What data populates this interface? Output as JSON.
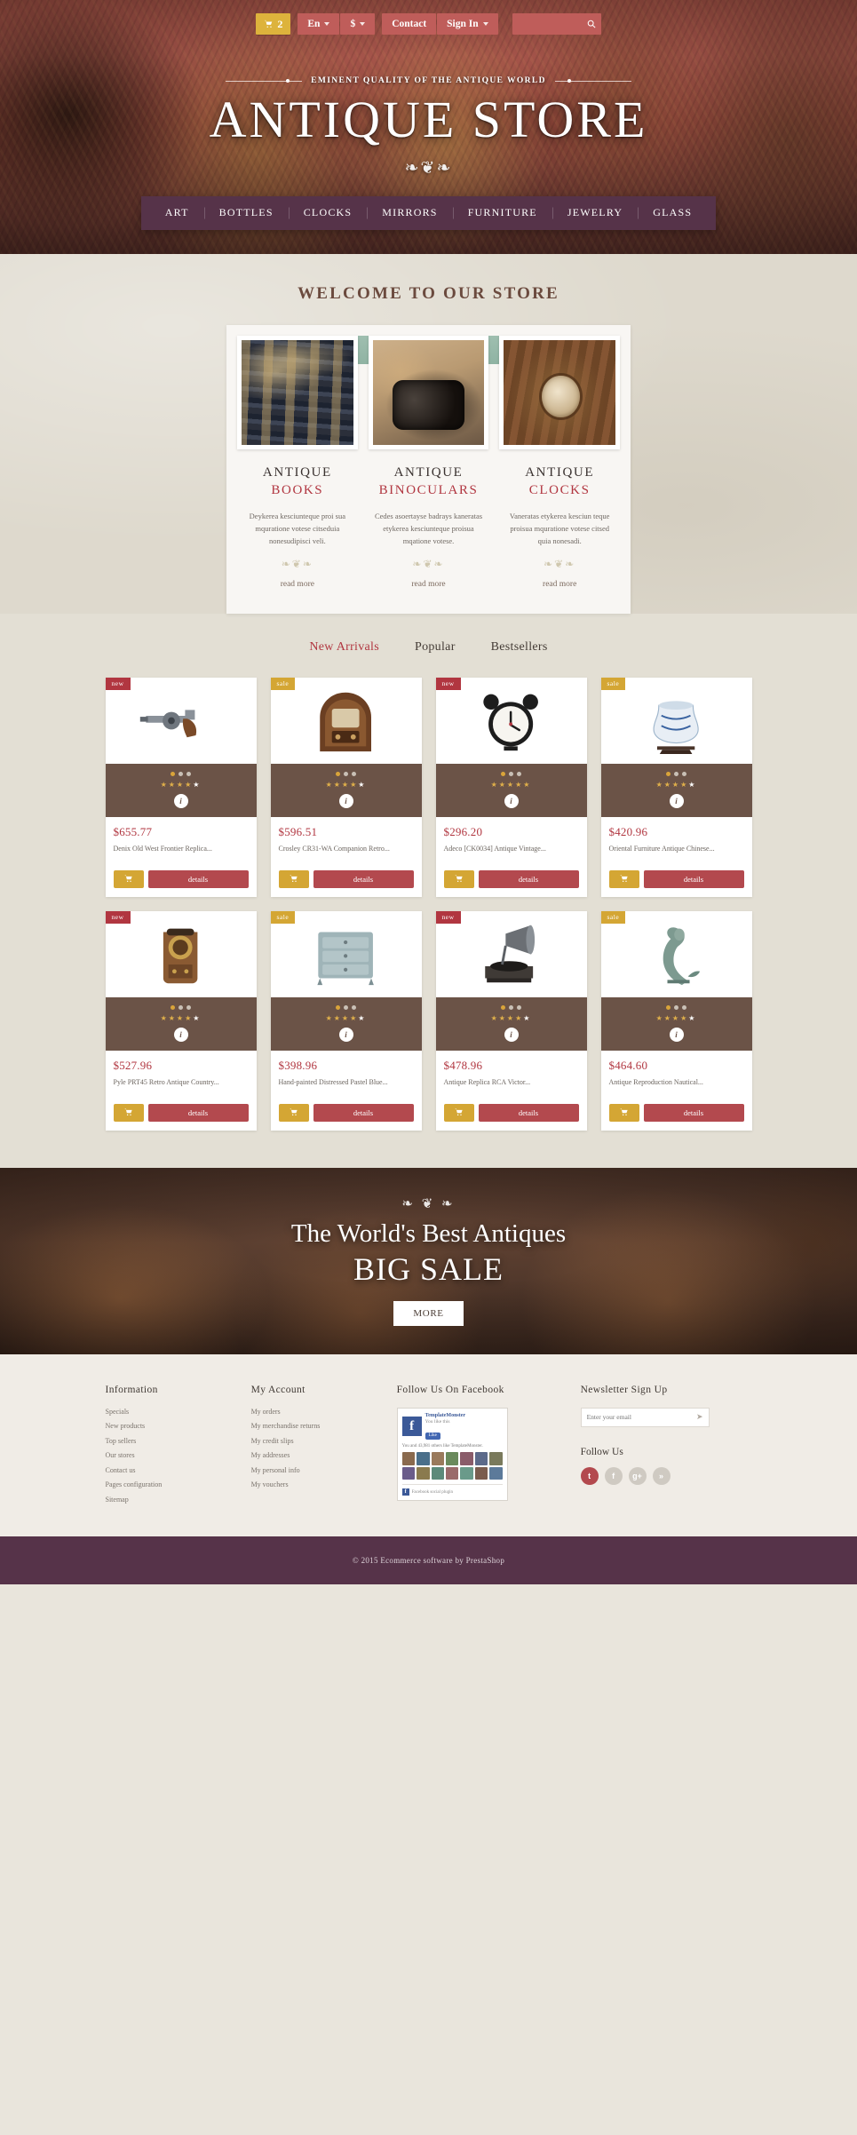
{
  "topbar": {
    "cart_count": "2",
    "cart_icon": "shopping-cart-icon",
    "language": "En",
    "currency": "$",
    "contact_label": "Contact",
    "signin_label": "Sign In",
    "search_placeholder": "",
    "search_value": "",
    "search_icon": "search-icon"
  },
  "hero": {
    "tagline": "EMINENT QUALITY OF THE ANTIQUE WORLD",
    "title": "ANTIQUE STORE",
    "flourish": "❧❦❧"
  },
  "nav": {
    "items": [
      {
        "label": "ART"
      },
      {
        "label": "BOTTLES"
      },
      {
        "label": "CLOCKS"
      },
      {
        "label": "MIRRORS"
      },
      {
        "label": "FURNITURE"
      },
      {
        "label": "JEWELRY"
      },
      {
        "label": "GLASS"
      }
    ]
  },
  "welcome": {
    "title": "WELCOME TO OUR STORE",
    "cards": [
      {
        "line1": "ANTIQUE",
        "line2": "BOOKS",
        "desc": "Deykerea kesciunteque proi sua mquratione votese citseduia nonesudipisci veli.",
        "ornament": "❧❦❧",
        "readmore": "read more",
        "image": "antique-books-image"
      },
      {
        "line1": "ANTIQUE",
        "line2": "BINOCULARS",
        "desc": "Cedes asoertayse badrays kaneratas etykerea kesciunteque proisua mqatione votese.",
        "ornament": "❧❦❧",
        "readmore": "read more",
        "image": "antique-binoculars-image"
      },
      {
        "line1": "ANTIQUE",
        "line2": "CLOCKS",
        "desc": "Vaneratas etykerea kesciun teque proisua mquratione votese citsed quia nonesadi.",
        "ornament": "❧❦❧",
        "readmore": "read more",
        "image": "antique-clocks-image"
      }
    ]
  },
  "products": {
    "tabs": [
      {
        "label": "New Arrivals",
        "active": true
      },
      {
        "label": "Popular",
        "active": false
      },
      {
        "label": "Bestsellers",
        "active": false
      }
    ],
    "items": [
      {
        "badge": "new",
        "badge_type": "new",
        "price": "$655.77",
        "name": "Denix Old West Frontier Replica...",
        "rating": 4,
        "dots": 3,
        "dots_active": 1,
        "image": "revolver-pistol-image",
        "details_label": "details",
        "cart_icon": "shopping-bag-icon",
        "info_icon": "info-icon"
      },
      {
        "badge": "sale",
        "badge_type": "sale",
        "price": "$596.51",
        "name": "Crosley CR31-WA Companion Retro...",
        "rating": 4,
        "dots": 3,
        "dots_active": 1,
        "image": "vintage-radio-image",
        "details_label": "details",
        "cart_icon": "shopping-bag-icon",
        "info_icon": "info-icon"
      },
      {
        "badge": "new",
        "badge_type": "new",
        "price": "$296.20",
        "name": "Adeco [CK0034] Antique Vintage...",
        "rating": 5,
        "dots": 3,
        "dots_active": 1,
        "image": "alarm-clock-image",
        "details_label": "details",
        "cart_icon": "shopping-bag-icon",
        "info_icon": "info-icon"
      },
      {
        "badge": "sale",
        "badge_type": "sale",
        "price": "$420.96",
        "name": "Oriental Furniture Antique Chinese...",
        "rating": 4,
        "dots": 3,
        "dots_active": 1,
        "image": "porcelain-vase-image",
        "details_label": "details",
        "cart_icon": "shopping-bag-icon",
        "info_icon": "info-icon"
      },
      {
        "badge": "new",
        "badge_type": "new",
        "price": "$527.96",
        "name": "Pyle PRT45 Retro Antique Country...",
        "rating": 4,
        "dots": 3,
        "dots_active": 1,
        "image": "antique-telephone-image",
        "details_label": "details",
        "cart_icon": "shopping-bag-icon",
        "info_icon": "info-icon"
      },
      {
        "badge": "sale",
        "badge_type": "sale",
        "price": "$398.96",
        "name": "Hand-painted Distressed Pastel Blue...",
        "rating": 4,
        "dots": 3,
        "dots_active": 1,
        "image": "dresser-cabinet-image",
        "details_label": "details",
        "cart_icon": "shopping-bag-icon",
        "info_icon": "info-icon"
      },
      {
        "badge": "new",
        "badge_type": "new",
        "price": "$478.96",
        "name": "Antique Replica RCA Victor...",
        "rating": 4,
        "dots": 3,
        "dots_active": 1,
        "image": "gramophone-image",
        "details_label": "details",
        "cart_icon": "shopping-bag-icon",
        "info_icon": "info-icon"
      },
      {
        "badge": "sale",
        "badge_type": "sale",
        "price": "$464.60",
        "name": "Antique Reproduction Nautical...",
        "rating": 4,
        "dots": 3,
        "dots_active": 1,
        "image": "mermaid-figurine-image",
        "details_label": "details",
        "cart_icon": "shopping-bag-icon",
        "info_icon": "info-icon"
      }
    ]
  },
  "sale_banner": {
    "ornament": "❧ ❦ ❧",
    "line1": "The World's Best Antiques",
    "line2": "BIG SALE",
    "button": "MORE"
  },
  "footer": {
    "columns": [
      {
        "heading": "Information",
        "links": [
          "Specials",
          "New products",
          "Top sellers",
          "Our stores",
          "Contact us",
          "Pages configuration",
          "Sitemap"
        ]
      },
      {
        "heading": "My Account",
        "links": [
          "My orders",
          "My merchandise returns",
          "My credit slips",
          "My addresses",
          "My personal info",
          "My vouchers"
        ]
      }
    ],
    "facebook": {
      "heading": "Follow Us On Facebook",
      "page_name": "TemplateMonster",
      "page_sub": "You like this",
      "like_label": "Like",
      "note": "You and 43,981 others like TemplateMonster.",
      "footer_note": "Facebook social plugin"
    },
    "newsletter": {
      "heading": "Newsletter Sign Up",
      "placeholder": "Enter your email",
      "submit_icon": "arrow-submit-icon"
    },
    "follow": {
      "heading": "Follow Us",
      "socials": [
        {
          "name": "twitter",
          "glyph": "t"
        },
        {
          "name": "facebook",
          "glyph": "f"
        },
        {
          "name": "google-plus",
          "glyph": "g+"
        },
        {
          "name": "rss",
          "glyph": "»"
        }
      ]
    }
  },
  "copyright": {
    "text": "© 2015 Ecommerce software by PrestaShop"
  },
  "colors": {
    "accent_red": "#b13640",
    "gold": "#d4a634",
    "plum": "#563349",
    "brown": "#6b5347",
    "pill": "#bf5d5a"
  }
}
